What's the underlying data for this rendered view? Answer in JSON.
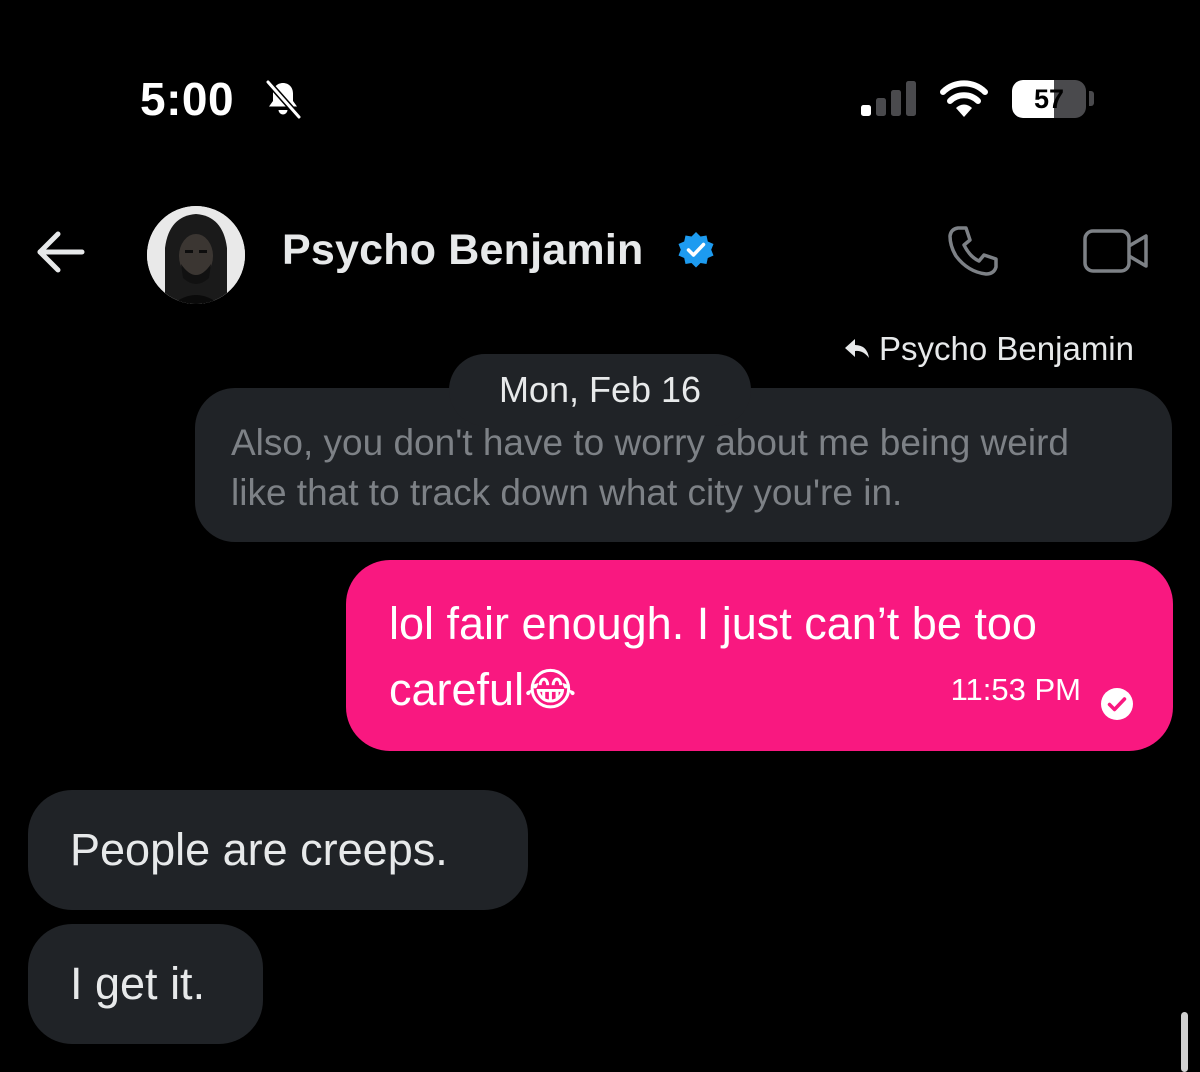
{
  "status_bar": {
    "time": "5:00",
    "battery_level": 57,
    "battery_text": "57",
    "icons": [
      "bell-off-icon",
      "cellular-signal-icon",
      "wifi-icon",
      "battery-icon"
    ]
  },
  "header": {
    "contact_name": "Psycho Benjamin",
    "verified": true,
    "icons": [
      "back-arrow-icon",
      "avatar",
      "verified-badge-icon",
      "phone-icon",
      "video-camera-icon"
    ]
  },
  "conversation": {
    "reply_to": "Psycho Benjamin",
    "date_separator": "Mon, Feb 16",
    "quoted_message": "Also, you don't have to worry about me being weird like that to track down what city you're in.",
    "outgoing": {
      "text": "lol fair enough. I just can’t be too careful😂",
      "time": "11:53 PM",
      "status": "read"
    },
    "incoming": [
      {
        "text": "People are creeps."
      },
      {
        "text": "I get it."
      }
    ]
  },
  "colors": {
    "background": "#000000",
    "outgoing_bubble": "#f91880",
    "incoming_bubble": "#202327",
    "verified_blue": "#1d9bf0",
    "primary_text": "#e7e9ea",
    "muted_text": "#7d8186"
  }
}
